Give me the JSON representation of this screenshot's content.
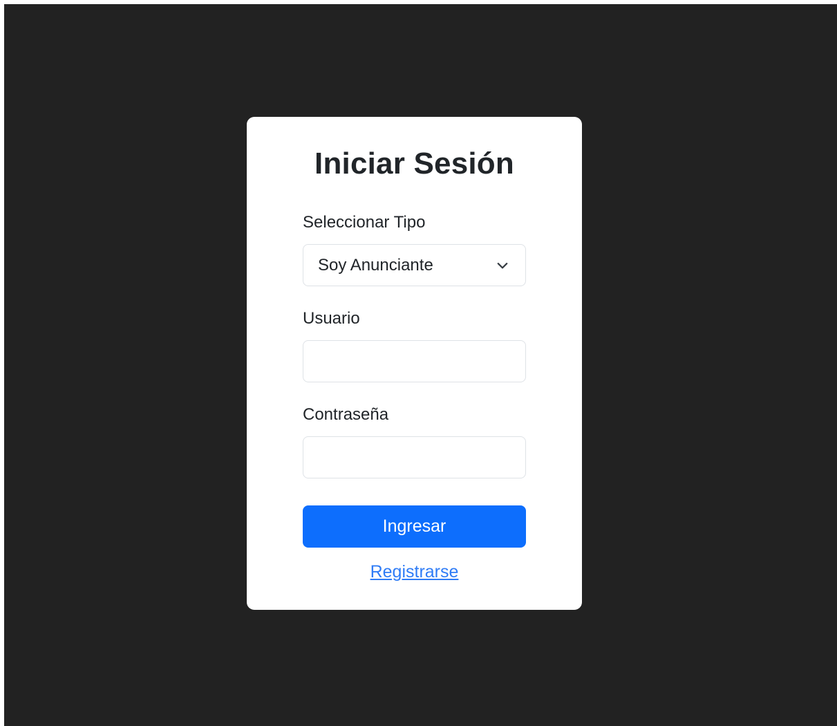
{
  "login": {
    "title": "Iniciar Sesión",
    "type_label": "Seleccionar Tipo",
    "type_selected": "Soy Anunciante",
    "user_label": "Usuario",
    "user_value": "",
    "password_label": "Contraseña",
    "password_value": "",
    "submit_label": "Ingresar",
    "register_link": "Registrarse"
  },
  "icons": {
    "select_chevron": "chevron-down-icon"
  },
  "colors": {
    "background": "#222222",
    "card": "#ffffff",
    "primary_button": "#0d6efd",
    "link": "#2f7cf6",
    "text": "#212529",
    "field_border": "#dee2e6"
  }
}
